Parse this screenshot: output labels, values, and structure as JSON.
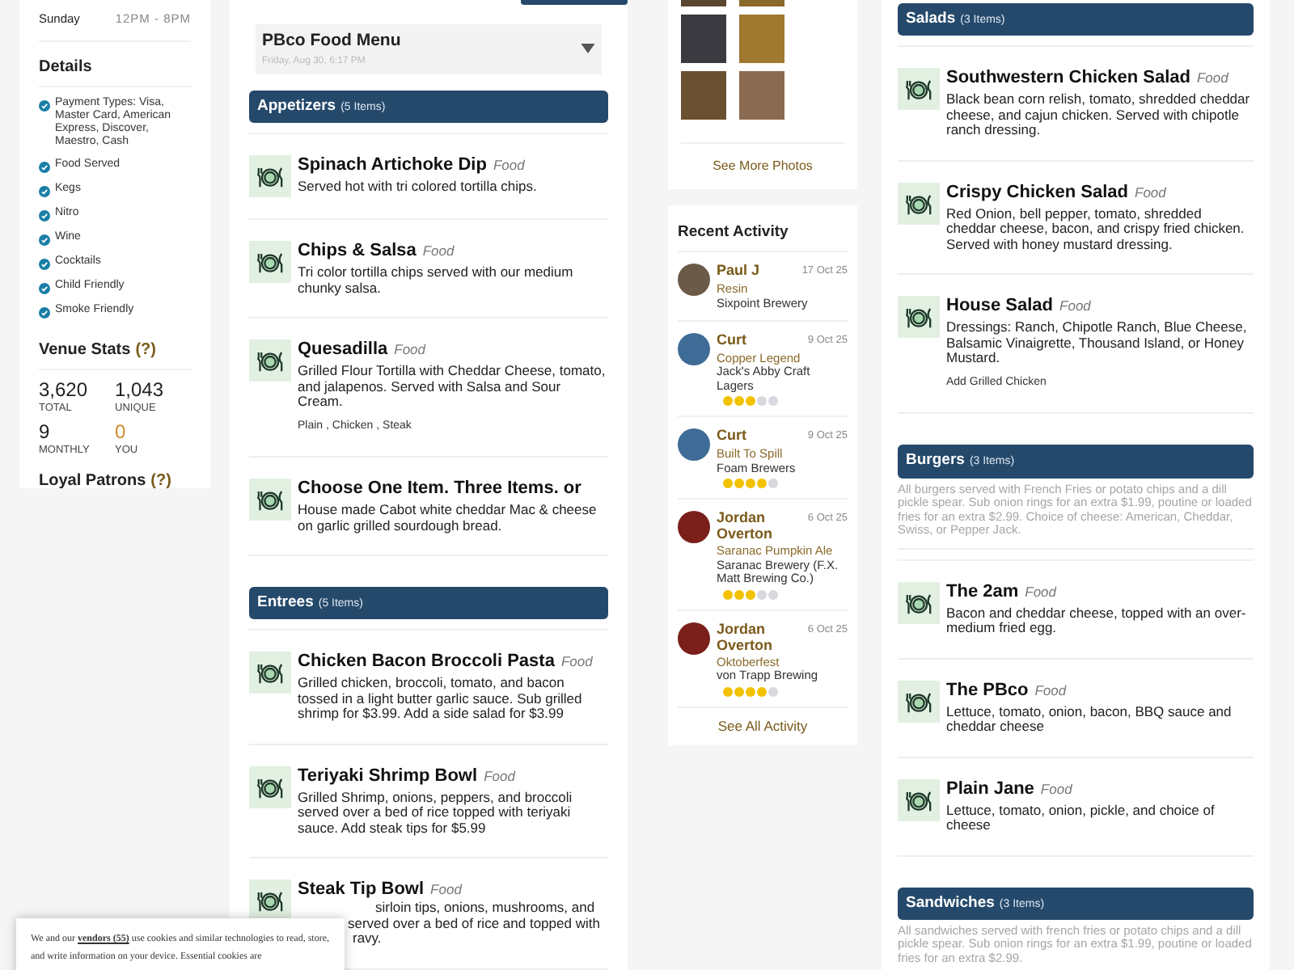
{
  "hours": [
    {
      "day": "Sunday",
      "time": "12PM - 8PM"
    }
  ],
  "details": {
    "title": "Details",
    "items": [
      "Payment Types: Visa, Master Card, American Express, Discover, Maestro, Cash",
      "Food Served",
      "Kegs",
      "Nitro",
      "Wine",
      "Cocktails",
      "Child Friendly",
      "Smoke Friendly"
    ]
  },
  "venue_stats": {
    "title": "Venue Stats",
    "help": "(?)",
    "stats": [
      {
        "value": "3,620",
        "label": "TOTAL",
        "highlight": false
      },
      {
        "value": "1,043",
        "label": "UNIQUE",
        "highlight": false
      },
      {
        "value": "9",
        "label": "MONTHLY",
        "highlight": false
      },
      {
        "value": "0",
        "label": "YOU",
        "highlight": true
      }
    ]
  },
  "loyal_patrons": {
    "title": "Loyal Patrons",
    "help": "(?)"
  },
  "menu": {
    "title": "PBco Food Menu",
    "updated": "Friday, Aug 30, 6:17 PM"
  },
  "menu_sections_left": [
    {
      "title": "Appetizers",
      "count": "(5 Items)",
      "items": [
        {
          "name": "Spinach Artichoke Dip",
          "type": "Food",
          "description": "Served hot with tri colored tortilla chips."
        },
        {
          "name": "Chips & Salsa",
          "type": "Food",
          "description": "Tri color tortilla chips served with our medium chunky salsa."
        },
        {
          "name": "Quesadilla",
          "type": "Food",
          "description": "Grilled Flour Tortilla with Cheddar Cheese, tomato, and jalapenos. Served with Salsa and Sour Cream.",
          "options": "Plain , Chicken , Steak"
        },
        {
          "name": "Choose One Item. Three Items. or",
          "description": "House made Cabot white cheddar Mac & cheese on garlic grilled sourdough bread."
        }
      ]
    },
    {
      "title": "Entrees",
      "count": "(5 Items)",
      "items": [
        {
          "name": "Chicken Bacon Broccoli Pasta",
          "type": "Food",
          "description": "Grilled chicken, broccoli, tomato, and bacon tossed in a light butter garlic sauce. Sub grilled shrimp for $3.99. Add a side salad for $3.99"
        },
        {
          "name": "Teriyaki Shrimp Bowl",
          "type": "Food",
          "description": "Grilled Shrimp, onions, peppers, and broccoli served over a bed of rice topped with teriyaki sauce. Add steak tips for $5.99"
        },
        {
          "name": "Steak Tip Bowl",
          "type": "Food",
          "description_lines": [
            "sirloin tips, onions, mushrooms, and",
            "served over a bed of rice and topped with",
            "ravy."
          ]
        }
      ]
    }
  ],
  "photos": {
    "link": "See More Photos"
  },
  "recent_activity": {
    "title": "Recent Activity",
    "entries": [
      {
        "user": "Paul J",
        "date": "17 Oct 25",
        "beer": "Resin",
        "brewery": "Sixpoint Brewery",
        "color": "#6b5a48"
      },
      {
        "user": "Curt",
        "date": "9 Oct 25",
        "beer": "Copper Legend",
        "brewery": "Jack's Abby Craft Lagers",
        "stars": 3,
        "color": "#3f6c97"
      },
      {
        "user": "Curt",
        "date": "9 Oct 25",
        "beer": "Built To Spill",
        "brewery": "Foam Brewers",
        "stars": 4,
        "color": "#3f6c97"
      },
      {
        "user": "Jordan Overton",
        "date": "6 Oct 25",
        "beer": "Saranac Pumpkin Ale",
        "brewery": "Saranac Brewery (F.X. Matt Brewing Co.)",
        "stars": 3,
        "color": "#7a1f1a"
      },
      {
        "user": "Jordan Overton",
        "date": "6 Oct 25",
        "beer": "Oktoberfest",
        "brewery": "von Trapp Brewing",
        "stars": 4,
        "color": "#7a1f1a"
      }
    ],
    "link": "See All Activity"
  },
  "menu_sections_right": [
    {
      "title": "Salads",
      "count": "(3 Items)",
      "items": [
        {
          "name": "Southwestern Chicken Salad",
          "type": "Food",
          "description": "Black bean corn relish, tomato, shredded cheddar cheese, and cajun chicken. Served with chipotle ranch dressing."
        },
        {
          "name": "Crispy Chicken Salad",
          "type": "Food",
          "description": "Red Onion, bell pepper, tomato, shredded cheddar cheese, bacon, and crispy fried chicken. Served with honey mustard dressing."
        },
        {
          "name": "House Salad",
          "type": "Food",
          "description": "Dressings: Ranch, Chipotle Ranch, Blue Cheese, Balsamic Vinaigrette, Thousand Island, or Honey Mustard.",
          "options": "Add Grilled Chicken"
        }
      ]
    },
    {
      "title": "Burgers",
      "count": "(3 Items)",
      "note": "All burgers served with French Fries or potato chips and a dill pickle spear. Sub onion rings for an extra $1.99, poutine or loaded fries for an extra $2.99. Choice of cheese: American, Cheddar, Swiss, or Pepper Jack.",
      "items": [
        {
          "name": "The 2am",
          "type": "Food",
          "description": "Bacon and cheddar cheese, topped with an over-medium fried egg."
        },
        {
          "name": "The PBco",
          "type": "Food",
          "description": "Lettuce, tomato, onion, bacon, BBQ sauce and cheddar cheese"
        },
        {
          "name": "Plain Jane",
          "type": "Food",
          "description": "Lettuce, tomato, onion, pickle, and choice of cheese"
        }
      ]
    },
    {
      "title": "Sandwiches",
      "count": "(3 Items)",
      "note": "All sandwiches served with french fries or potato chips and a dill pickle spear. Sub onion rings for an extra $1.99, poutine or loaded fries for an extra $2.99."
    }
  ],
  "cookie_banner": {
    "before": "We and our",
    "link": "vendors (55)",
    "after": "use cookies and similar technologies to read, store, and write information on your device. Essential cookies are"
  }
}
